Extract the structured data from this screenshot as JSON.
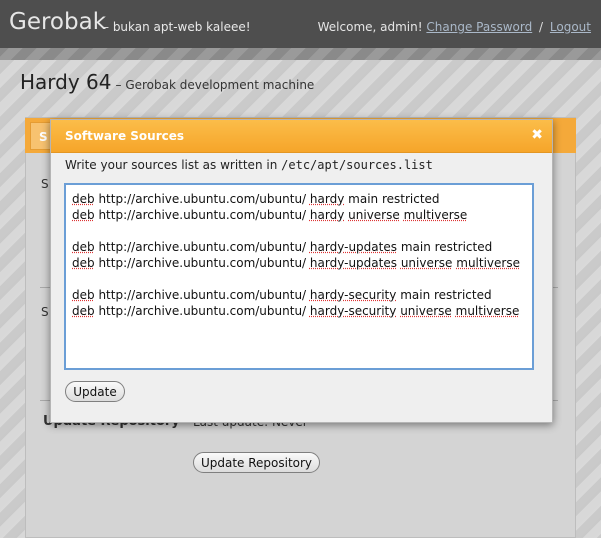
{
  "header": {
    "brand": "Gerobak",
    "tagline": "– bukan apt-web kaleee!",
    "welcome": "Welcome, admin!",
    "change_password": "Change Password",
    "separator": "/",
    "logout": "Logout"
  },
  "page": {
    "title": "Hardy 64",
    "subtitle": "– Gerobak development machine",
    "section_label_1": "S",
    "section_label_2": "S",
    "tab_label": "S",
    "repo_label": "Update Repository",
    "repo_status": "Last update: Never",
    "update_repo_button": "Update Repository"
  },
  "dialog": {
    "title": "Software Sources",
    "close_glyph": "✖",
    "instruction": "Write your sources list as written in",
    "path": "/etc/apt/sources.list",
    "sources": [
      "deb http://archive.ubuntu.com/ubuntu/ hardy main restricted",
      "deb http://archive.ubuntu.com/ubuntu/ hardy universe multiverse",
      "",
      "deb http://archive.ubuntu.com/ubuntu/ hardy-updates main restricted",
      "deb http://archive.ubuntu.com/ubuntu/ hardy-updates universe multiverse",
      "",
      "deb http://archive.ubuntu.com/ubuntu/ hardy-security main restricted",
      "deb http://archive.ubuntu.com/ubuntu/ hardy-security universe multiverse"
    ],
    "update_button": "Update"
  }
}
